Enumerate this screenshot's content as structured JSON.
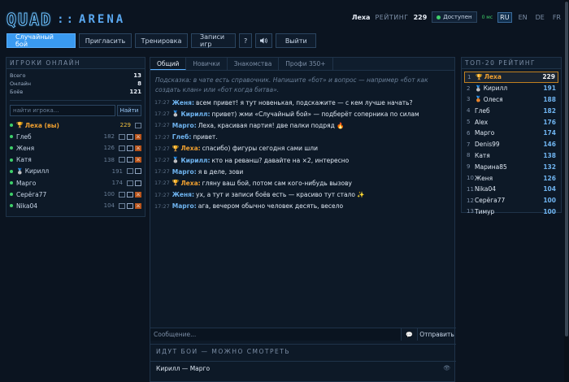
{
  "header": {
    "logo_quad": "QUAD",
    "logo_sep": "::",
    "logo_arena": "ARENA",
    "user": "Леха",
    "rating_label": "РЕЙТИНГ",
    "rating_value": "229",
    "status": "Доступен",
    "ping": "0 мс",
    "languages": [
      "RU",
      "EN",
      "DE",
      "FR"
    ],
    "active_language": "RU"
  },
  "toolbar": {
    "random_battle": "Случайный бой",
    "invite": "Пригласить",
    "training": "Тренировка",
    "recordings": "Записи игр",
    "help": "?",
    "sound_icon": "speaker-icon",
    "exit": "Выйти"
  },
  "online": {
    "title": "ИГРОКИ ОНЛАЙН",
    "stats": [
      {
        "label": "Всего",
        "value": "13"
      },
      {
        "label": "Онлайн",
        "value": "8"
      },
      {
        "label": "Боёв",
        "value": "121"
      }
    ],
    "search_placeholder": "найти игрока...",
    "search_button": "Найти",
    "players": [
      {
        "name": "Леха (вы)",
        "rating": "229"
      },
      {
        "name": "Глеб",
        "rating": "182"
      },
      {
        "name": "Женя",
        "rating": "126"
      },
      {
        "name": "Катя",
        "rating": "138"
      },
      {
        "name": "Кирилл",
        "rating": "191"
      },
      {
        "name": "Марго",
        "rating": "174"
      },
      {
        "name": "Серёга77",
        "rating": "100"
      },
      {
        "name": "Nika04",
        "rating": "104"
      }
    ]
  },
  "chat": {
    "tabs": [
      "Общий",
      "Новички",
      "Знакомства",
      "Профи 350+"
    ],
    "hint": "Подсказка: в чате есть справочник. Напишите «бот» и вопрос — например «бот как создать клан» или «бот когда битва».",
    "messages": [
      {
        "time": "17:27",
        "author": "Женя:",
        "text": "всем привет! я тут новенькая, подскажите — с кем лучше начать?"
      },
      {
        "time": "17:27",
        "author": "Кирилл:",
        "text": "привет) жми «Случайный бой» — подберёт соперника по силам"
      },
      {
        "time": "17:27",
        "author": "Марго:",
        "text": "Леха, красивая партия! две палки подряд 🔥"
      },
      {
        "time": "17:27",
        "author": "Глеб:",
        "text": "привет."
      },
      {
        "time": "17:27",
        "author": "Леха:",
        "text": "спасибо) фигуры сегодня сами шли"
      },
      {
        "time": "17:27",
        "author": "Кирилл:",
        "text": "кто на реванш? давайте на ×2, интересно"
      },
      {
        "time": "17:27",
        "author": "Марго:",
        "text": "я в деле, зови"
      },
      {
        "time": "17:27",
        "author": "Леха:",
        "text": "гляну ваш бой, потом сам кого-нибудь вызову"
      },
      {
        "time": "17:27",
        "author": "Женя:",
        "text": "ух, а тут и записи боёв есть — красиво тут стало ✨"
      },
      {
        "time": "17:27",
        "author": "Марго:",
        "text": "ага, вечером обычно человек десять, весело"
      }
    ],
    "composer_placeholder": "Сообщение...",
    "send": "Отправить"
  },
  "live": {
    "title": "ИДУТ БОИ — МОЖНО СМОТРЕТЬ",
    "match": "Кирилл — Марго"
  },
  "top": {
    "title": "ТОП-20 РЕЙТИНГ",
    "rows": [
      {
        "rank": "1",
        "name": "Леха",
        "score": "229"
      },
      {
        "rank": "2",
        "name": "Кирилл",
        "score": "191"
      },
      {
        "rank": "3",
        "name": "Олеся",
        "score": "188"
      },
      {
        "rank": "4",
        "name": "Глеб",
        "score": "182"
      },
      {
        "rank": "5",
        "name": "Alex",
        "score": "176"
      },
      {
        "rank": "6",
        "name": "Марго",
        "score": "174"
      },
      {
        "rank": "7",
        "name": "Denis99",
        "score": "146"
      },
      {
        "rank": "8",
        "name": "Катя",
        "score": "138"
      },
      {
        "rank": "9",
        "name": "Марина85",
        "score": "132"
      },
      {
        "rank": "10",
        "name": "Женя",
        "score": "126"
      },
      {
        "rank": "11",
        "name": "Nika04",
        "score": "104"
      },
      {
        "rank": "12",
        "name": "Серёга77",
        "score": "100"
      },
      {
        "rank": "13",
        "name": "Тимур",
        "score": "100"
      }
    ]
  }
}
